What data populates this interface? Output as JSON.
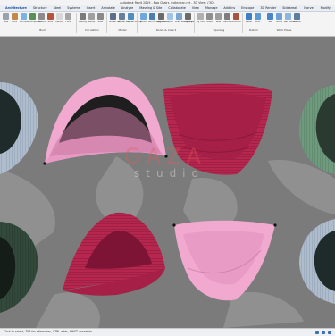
{
  "app": {
    "title": "Autodesk Revit 2019 - Egg Chairs_Collection.rvt - 3D View: {3D}"
  },
  "ribbon_tabs": [
    "Architecture",
    "Structure",
    "Steel",
    "Systems",
    "Insert",
    "Annotate",
    "Analyze",
    "Massing & Site",
    "Collaborate",
    "View",
    "Manage",
    "Add-Ins",
    "Enscape",
    "3D Render",
    "Sidebreak",
    "Marvel",
    "Modify"
  ],
  "active_tab": "Architecture",
  "tools": {
    "wall": "Wall",
    "door": "Door",
    "window": "Window",
    "component": "Component",
    "column": "Column",
    "roof": "Roof",
    "ceiling": "Ceiling",
    "floor": "Floor",
    "curtain_system": "Curtain System",
    "curtain_grid": "Curtain Grid",
    "mullion": "Mullion",
    "railing": "Railing",
    "ramp": "Ramp",
    "stair": "Stair",
    "model_text": "Model Text",
    "model_line": "Model Line",
    "model_group": "Model Group",
    "room": "Room",
    "room_separator": "Room Separator",
    "tag_room": "Tag Room",
    "area": "Area",
    "area_boundary": "Area Boundary",
    "tag_area": "Tag Area",
    "by_face": "By Face",
    "shaft": "Shaft",
    "wall_opening": "Wall",
    "vertical": "Vertical",
    "dormer": "Dormer",
    "level": "Level",
    "grid": "Grid",
    "set": "Set",
    "show": "Show",
    "ref_plane": "Ref Plane",
    "viewer": "Viewer"
  },
  "groups": {
    "build": "Build",
    "circulation": "Circulation",
    "model": "Model",
    "room_area": "Room & Area ▾",
    "opening": "Opening",
    "datum": "Datum",
    "work_plane": "Work Plane"
  },
  "viewport": {
    "watermark_main": "GAZA",
    "watermark_sub": "studio",
    "colors": {
      "pink_light": "#f1a9cf",
      "pink_shadow": "#c97aa3",
      "raspberry": "#b7264f",
      "raspberry_dark": "#7d1436",
      "green": "#6f9a7e",
      "dark_green": "#33493b",
      "gray_blue": "#aebccc",
      "floor": "#7b7b7b"
    }
  },
  "status": {
    "text": "Click to select, TAB for alternates, CTRL adds, SHIFT unselects."
  }
}
